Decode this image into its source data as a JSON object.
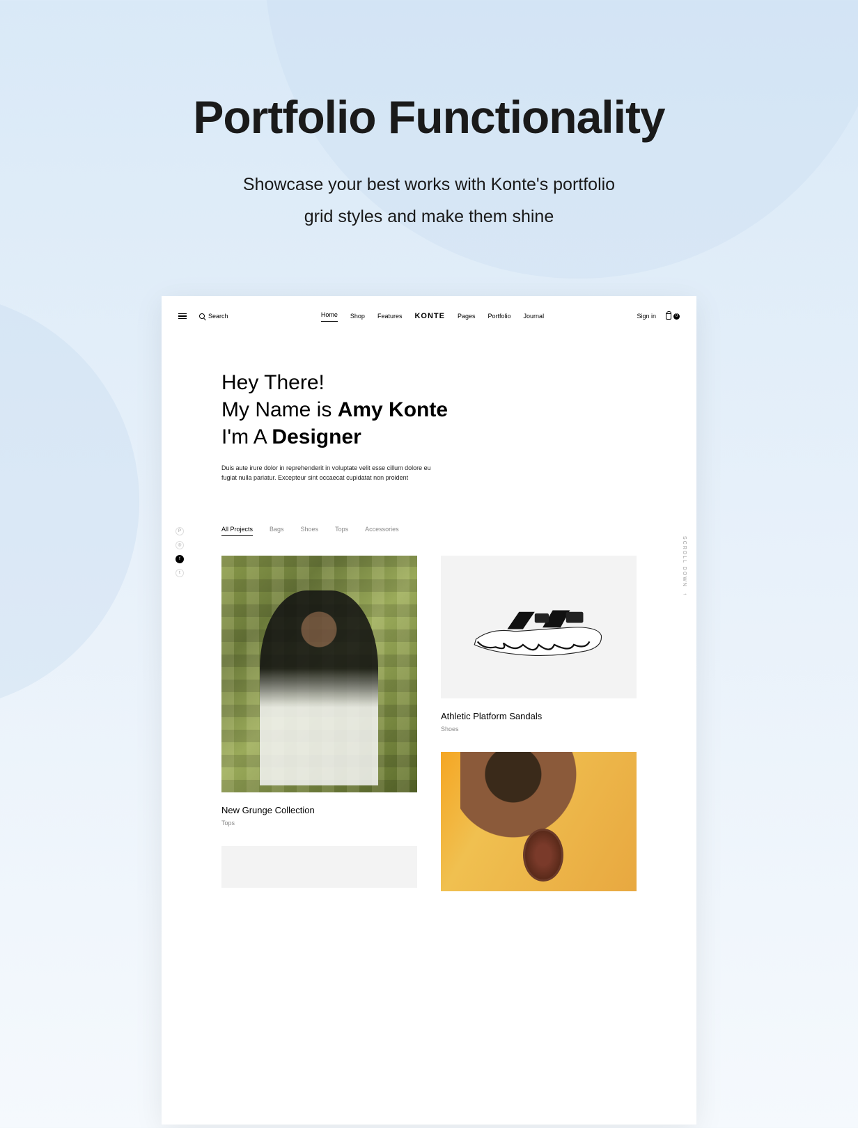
{
  "outer": {
    "title": "Portfolio Functionality",
    "subtitle_l1": "Showcase your best works with Konte's portfolio",
    "subtitle_l2": "grid styles and make them shine"
  },
  "header": {
    "search": "Search",
    "logo": "KONTE",
    "signin": "Sign in",
    "cart_count": "0",
    "nav": [
      {
        "label": "Home",
        "active": true
      },
      {
        "label": "Shop"
      },
      {
        "label": "Features"
      },
      {
        "label": "Pages"
      },
      {
        "label": "Portfolio"
      },
      {
        "label": "Journal"
      }
    ]
  },
  "hero": {
    "line1": "Hey There!",
    "line2a": "My Name is ",
    "line2b": "Amy Konte",
    "line3a": "I'm A ",
    "line3b": "Designer",
    "desc": "Duis aute irure dolor in reprehenderit in voluptate velit esse cillum dolore eu fugiat nulla pariatur. Excepteur sint occaecat cupidatat non proident"
  },
  "filters": [
    {
      "label": "All Projects",
      "active": true
    },
    {
      "label": "Bags"
    },
    {
      "label": "Shoes"
    },
    {
      "label": "Tops"
    },
    {
      "label": "Accessories"
    }
  ],
  "scroll": "SCROLL DOWN",
  "cards": {
    "grunge": {
      "title": "New Grunge Collection",
      "cat": "Tops"
    },
    "sandals": {
      "title": "Athletic Platform Sandals",
      "cat": "Shoes"
    }
  }
}
